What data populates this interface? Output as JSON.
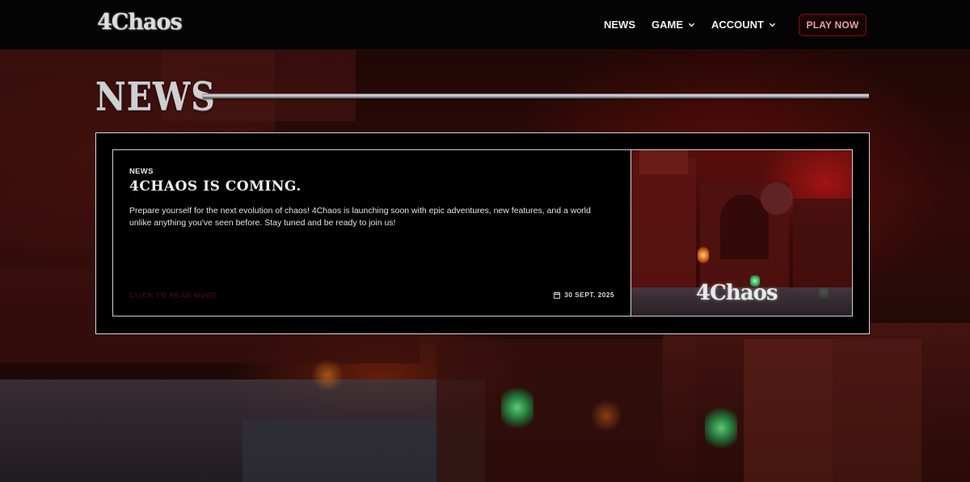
{
  "brand": {
    "logo_text": "4Chaos"
  },
  "nav": {
    "items": [
      {
        "label": "NEWS",
        "has_dropdown": false
      },
      {
        "label": "GAME",
        "has_dropdown": true
      },
      {
        "label": "ACCOUNT",
        "has_dropdown": true
      }
    ],
    "cta_label": "PLAY NOW"
  },
  "page": {
    "title": "NEWS"
  },
  "news": [
    {
      "category": "NEWS",
      "title": "4CHAOS IS COMING.",
      "description": "Prepare yourself for the next evolution of chaos! 4Chaos is launching soon with epic adventures, new features, and a world unlike anything you've seen before. Stay tuned and be ready to join us!",
      "read_more": "CLICK TO READ MORE",
      "date": "30 SEPT. 2025",
      "image_logo_text": "4Chaos"
    }
  ],
  "colors": {
    "accent": "#6a1016",
    "cta_text": "#e6a0a0",
    "read_more": "#3a0b0e",
    "panel_border": "#d8d8d8"
  },
  "icons": {
    "dropdown": "chevron-down-icon",
    "date": "calendar-icon"
  }
}
